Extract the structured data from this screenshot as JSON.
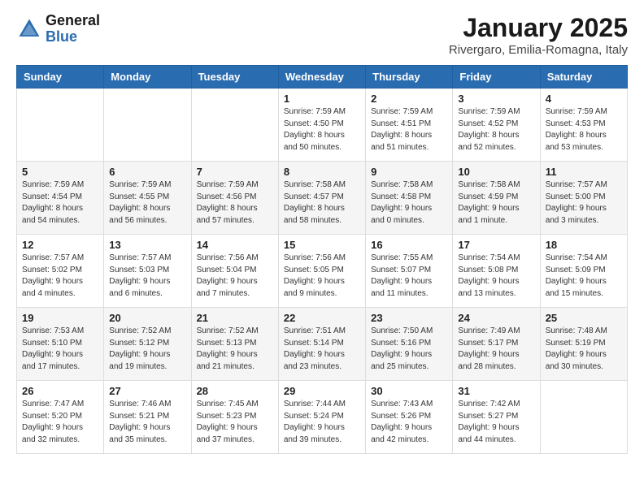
{
  "header": {
    "logo_general": "General",
    "logo_blue": "Blue",
    "month_title": "January 2025",
    "location": "Rivergaro, Emilia-Romagna, Italy"
  },
  "weekdays": [
    "Sunday",
    "Monday",
    "Tuesday",
    "Wednesday",
    "Thursday",
    "Friday",
    "Saturday"
  ],
  "weeks": [
    [
      {
        "day": "",
        "info": ""
      },
      {
        "day": "",
        "info": ""
      },
      {
        "day": "",
        "info": ""
      },
      {
        "day": "1",
        "info": "Sunrise: 7:59 AM\nSunset: 4:50 PM\nDaylight: 8 hours\nand 50 minutes."
      },
      {
        "day": "2",
        "info": "Sunrise: 7:59 AM\nSunset: 4:51 PM\nDaylight: 8 hours\nand 51 minutes."
      },
      {
        "day": "3",
        "info": "Sunrise: 7:59 AM\nSunset: 4:52 PM\nDaylight: 8 hours\nand 52 minutes."
      },
      {
        "day": "4",
        "info": "Sunrise: 7:59 AM\nSunset: 4:53 PM\nDaylight: 8 hours\nand 53 minutes."
      }
    ],
    [
      {
        "day": "5",
        "info": "Sunrise: 7:59 AM\nSunset: 4:54 PM\nDaylight: 8 hours\nand 54 minutes."
      },
      {
        "day": "6",
        "info": "Sunrise: 7:59 AM\nSunset: 4:55 PM\nDaylight: 8 hours\nand 56 minutes."
      },
      {
        "day": "7",
        "info": "Sunrise: 7:59 AM\nSunset: 4:56 PM\nDaylight: 8 hours\nand 57 minutes."
      },
      {
        "day": "8",
        "info": "Sunrise: 7:58 AM\nSunset: 4:57 PM\nDaylight: 8 hours\nand 58 minutes."
      },
      {
        "day": "9",
        "info": "Sunrise: 7:58 AM\nSunset: 4:58 PM\nDaylight: 9 hours\nand 0 minutes."
      },
      {
        "day": "10",
        "info": "Sunrise: 7:58 AM\nSunset: 4:59 PM\nDaylight: 9 hours\nand 1 minute."
      },
      {
        "day": "11",
        "info": "Sunrise: 7:57 AM\nSunset: 5:00 PM\nDaylight: 9 hours\nand 3 minutes."
      }
    ],
    [
      {
        "day": "12",
        "info": "Sunrise: 7:57 AM\nSunset: 5:02 PM\nDaylight: 9 hours\nand 4 minutes."
      },
      {
        "day": "13",
        "info": "Sunrise: 7:57 AM\nSunset: 5:03 PM\nDaylight: 9 hours\nand 6 minutes."
      },
      {
        "day": "14",
        "info": "Sunrise: 7:56 AM\nSunset: 5:04 PM\nDaylight: 9 hours\nand 7 minutes."
      },
      {
        "day": "15",
        "info": "Sunrise: 7:56 AM\nSunset: 5:05 PM\nDaylight: 9 hours\nand 9 minutes."
      },
      {
        "day": "16",
        "info": "Sunrise: 7:55 AM\nSunset: 5:07 PM\nDaylight: 9 hours\nand 11 minutes."
      },
      {
        "day": "17",
        "info": "Sunrise: 7:54 AM\nSunset: 5:08 PM\nDaylight: 9 hours\nand 13 minutes."
      },
      {
        "day": "18",
        "info": "Sunrise: 7:54 AM\nSunset: 5:09 PM\nDaylight: 9 hours\nand 15 minutes."
      }
    ],
    [
      {
        "day": "19",
        "info": "Sunrise: 7:53 AM\nSunset: 5:10 PM\nDaylight: 9 hours\nand 17 minutes."
      },
      {
        "day": "20",
        "info": "Sunrise: 7:52 AM\nSunset: 5:12 PM\nDaylight: 9 hours\nand 19 minutes."
      },
      {
        "day": "21",
        "info": "Sunrise: 7:52 AM\nSunset: 5:13 PM\nDaylight: 9 hours\nand 21 minutes."
      },
      {
        "day": "22",
        "info": "Sunrise: 7:51 AM\nSunset: 5:14 PM\nDaylight: 9 hours\nand 23 minutes."
      },
      {
        "day": "23",
        "info": "Sunrise: 7:50 AM\nSunset: 5:16 PM\nDaylight: 9 hours\nand 25 minutes."
      },
      {
        "day": "24",
        "info": "Sunrise: 7:49 AM\nSunset: 5:17 PM\nDaylight: 9 hours\nand 28 minutes."
      },
      {
        "day": "25",
        "info": "Sunrise: 7:48 AM\nSunset: 5:19 PM\nDaylight: 9 hours\nand 30 minutes."
      }
    ],
    [
      {
        "day": "26",
        "info": "Sunrise: 7:47 AM\nSunset: 5:20 PM\nDaylight: 9 hours\nand 32 minutes."
      },
      {
        "day": "27",
        "info": "Sunrise: 7:46 AM\nSunset: 5:21 PM\nDaylight: 9 hours\nand 35 minutes."
      },
      {
        "day": "28",
        "info": "Sunrise: 7:45 AM\nSunset: 5:23 PM\nDaylight: 9 hours\nand 37 minutes."
      },
      {
        "day": "29",
        "info": "Sunrise: 7:44 AM\nSunset: 5:24 PM\nDaylight: 9 hours\nand 39 minutes."
      },
      {
        "day": "30",
        "info": "Sunrise: 7:43 AM\nSunset: 5:26 PM\nDaylight: 9 hours\nand 42 minutes."
      },
      {
        "day": "31",
        "info": "Sunrise: 7:42 AM\nSunset: 5:27 PM\nDaylight: 9 hours\nand 44 minutes."
      },
      {
        "day": "",
        "info": ""
      }
    ]
  ]
}
